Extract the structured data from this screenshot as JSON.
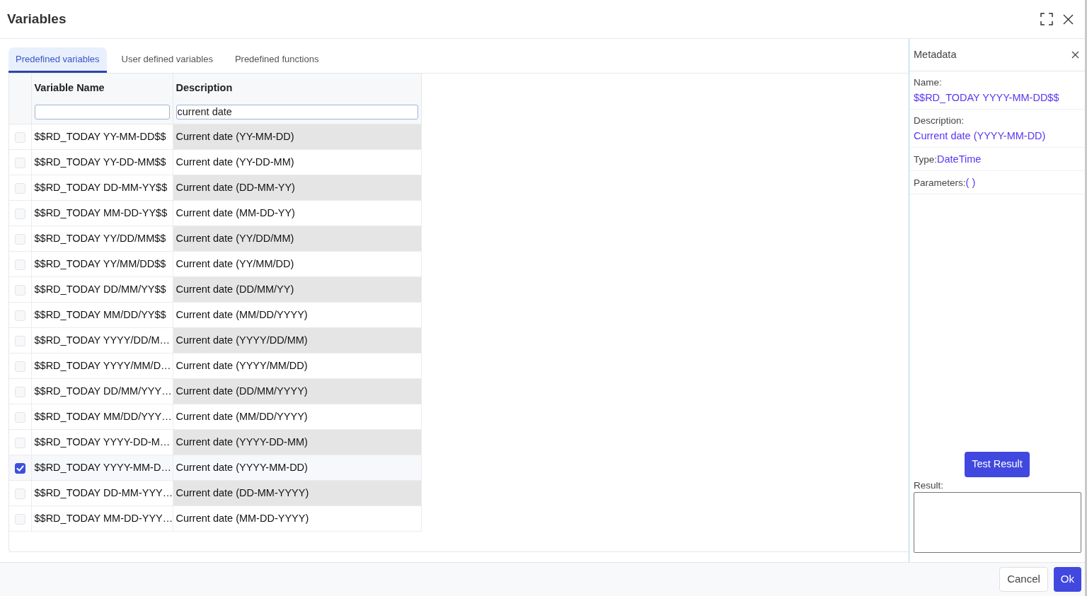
{
  "window": {
    "title": "Variables"
  },
  "tabs": [
    {
      "label": "Predefined variables",
      "selected": true
    },
    {
      "label": "User defined variables",
      "selected": false
    },
    {
      "label": "Predefined functions",
      "selected": false
    }
  ],
  "table": {
    "columns": [
      {
        "label": "Variable Name"
      },
      {
        "label": "Description",
        "filter_value": "current date"
      }
    ],
    "rows": [
      {
        "name": "$$RD_TODAY YY-MM-DD$$",
        "description": "Current date (YY-MM-DD)",
        "checked": false
      },
      {
        "name": "$$RD_TODAY YY-DD-MM$$",
        "description": "Current date (YY-DD-MM)",
        "checked": false
      },
      {
        "name": "$$RD_TODAY DD-MM-YY$$",
        "description": "Current date (DD-MM-YY)",
        "checked": false
      },
      {
        "name": "$$RD_TODAY MM-DD-YY$$",
        "description": "Current date (MM-DD-YY)",
        "checked": false
      },
      {
        "name": "$$RD_TODAY YY/DD/MM$$",
        "description": "Current date (YY/DD/MM)",
        "checked": false
      },
      {
        "name": "$$RD_TODAY YY/MM/DD$$",
        "description": "Current date (YY/MM/DD)",
        "checked": false
      },
      {
        "name": "$$RD_TODAY DD/MM/YY$$",
        "description": "Current date (DD/MM/YY)",
        "checked": false
      },
      {
        "name": "$$RD_TODAY MM/DD/YY$$",
        "description": "Current date (MM/DD/YYYY)",
        "checked": false
      },
      {
        "name": "$$RD_TODAY YYYY/DD/M…",
        "description": "Current date (YYYY/DD/MM)",
        "checked": false
      },
      {
        "name": "$$RD_TODAY YYYY/MM/D…",
        "description": "Current date (YYYY/MM/DD)",
        "checked": false
      },
      {
        "name": "$$RD_TODAY DD/MM/YYY…",
        "description": "Current date (DD/MM/YYYY)",
        "checked": false
      },
      {
        "name": "$$RD_TODAY MM/DD/YYY…",
        "description": "Current date (MM/DD/YYYY)",
        "checked": false
      },
      {
        "name": "$$RD_TODAY YYYY-DD-M…",
        "description": "Current date (YYYY-DD-MM)",
        "checked": false
      },
      {
        "name": "$$RD_TODAY YYYY-MM-D…",
        "description": "Current date (YYYY-MM-DD)",
        "checked": true
      },
      {
        "name": "$$RD_TODAY DD-MM-YYY…",
        "description": "Current date (DD-MM-YYYY)",
        "checked": false
      },
      {
        "name": "$$RD_TODAY MM-DD-YYY…",
        "description": "Current date (MM-DD-YYYY)",
        "checked": false
      }
    ]
  },
  "metadata": {
    "title": "Metadata",
    "fields": [
      {
        "label": "Name:",
        "value": "$$RD_TODAY YYYY-MM-DD$$",
        "kind": "stacked"
      },
      {
        "label": "Description:",
        "value": "Current date (YYYY-MM-DD)",
        "kind": "stacked"
      },
      {
        "label": "Type:",
        "value": "DateTime",
        "kind": "inline"
      },
      {
        "label": "Parameters:",
        "value": "( )",
        "kind": "inline"
      }
    ],
    "test_button": {
      "label": "Test Result"
    },
    "result": {
      "label": "Result:"
    }
  },
  "footer": {
    "buttons": [
      {
        "label": "Cancel",
        "kind": "cancel"
      },
      {
        "label": "Ok",
        "kind": "confirm"
      }
    ]
  }
}
